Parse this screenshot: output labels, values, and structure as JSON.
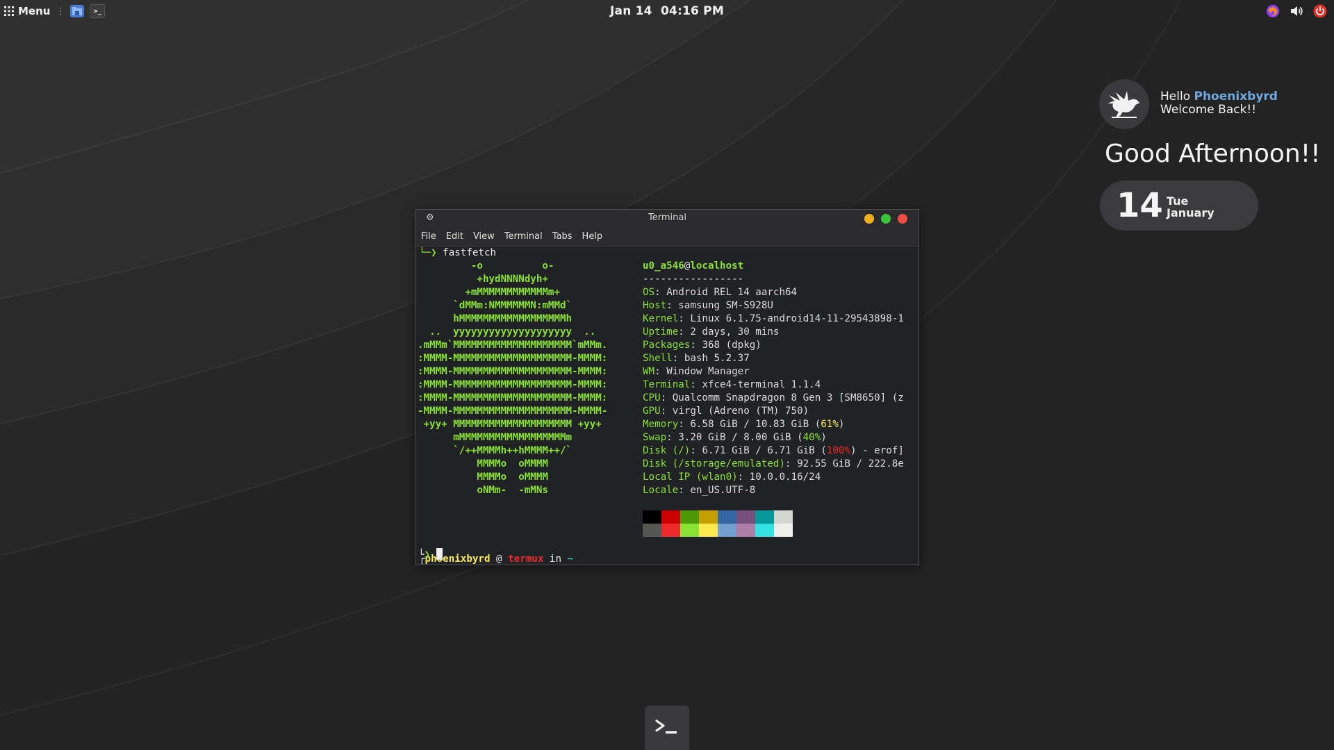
{
  "panel": {
    "menu_label": "Menu",
    "clock": "Jan 14  04:16 PM",
    "icons": [
      "apps-grid-icon",
      "file-manager-icon",
      "terminal-icon",
      "firefox-icon",
      "volume-icon",
      "power-icon"
    ]
  },
  "greeting": {
    "hello": "Hello",
    "user": "Phoenixbyrd",
    "welcome": "Welcome Back!!",
    "message": "Good Afternoon!!",
    "day_num": "14",
    "day_name": "Tue",
    "month": "January"
  },
  "terminal": {
    "title": "Terminal",
    "menu": [
      "File",
      "Edit",
      "View",
      "Terminal",
      "Tabs",
      "Help"
    ],
    "command_prefix": "└─❯ ",
    "command": "fastfetch",
    "logo": [
      "         -o          o-",
      "          +hydNNNNdyh+",
      "        +mMMMMMMMMMMMMm+",
      "      `dMMm:NMMMMMMN:mMMd`",
      "      hMMMMMMMMMMMMMMMMMMh",
      "  ..  yyyyyyyyyyyyyyyyyyyy  ..",
      ".mMMm`MMMMMMMMMMMMMMMMMMMM`mMMm.",
      ":MMMM-MMMMMMMMMMMMMMMMMMMM-MMMM:",
      ":MMMM-MMMMMMMMMMMMMMMMMMMM-MMMM:",
      ":MMMM-MMMMMMMMMMMMMMMMMMMM-MMMM:",
      ":MMMM-MMMMMMMMMMMMMMMMMMMM-MMMM:",
      "-MMMM-MMMMMMMMMMMMMMMMMMMM-MMMM-",
      " +yy+ MMMMMMMMMMMMMMMMMMMM +yy+",
      "      mMMMMMMMMMMMMMMMMMMm",
      "      `/++MMMMh++hMMMM++/`",
      "          MMMMo  oMMMM",
      "          MMMMo  oMMMM",
      "          oNMm-  -mMNs"
    ],
    "user": "u0_a546",
    "at": "@",
    "host": "localhost",
    "separator": "-----------------",
    "info": {
      "os_l": "OS",
      "os_v": "Android REL 14 aarch64",
      "host_l": "Host",
      "host_v": "samsung SM-S928U",
      "kernel_l": "Kernel",
      "kernel_v": "Linux 6.1.75-android14-11-29543898-1",
      "uptime_l": "Uptime",
      "uptime_v": "2 days, 30 mins",
      "packages_l": "Packages",
      "packages_v": "368 (dpkg)",
      "shell_l": "Shell",
      "shell_v": "bash 5.2.37",
      "wm_l": "WM",
      "wm_v": "Window Manager",
      "terminal_l": "Terminal",
      "terminal_v": "xfce4-terminal 1.1.4",
      "cpu_l": "CPU",
      "cpu_v": "Qualcomm Snapdragon 8 Gen 3 [SM8650] (z",
      "gpu_l": "GPU",
      "gpu_v": "virgl (Adreno (TM) 750)",
      "memory_l": "Memory",
      "memory_v": "6.58 GiB / 10.83 GiB (",
      "memory_pct": "61%",
      "memory_end": ")",
      "swap_l": "Swap",
      "swap_v": "3.20 GiB / 8.00 GiB (",
      "swap_pct": "40%",
      "swap_end": ")",
      "disk_l": "Disk (/)",
      "disk_v": "6.71 GiB / 6.71 GiB (",
      "disk_pct": "100%",
      "disk_end": ") - erof]",
      "disk2_l": "Disk (/storage/emulated)",
      "disk2_v": "92.55 GiB / 222.8e",
      "ip_l": "Local IP (wlan0)",
      "ip_v": "10.0.0.16/24",
      "locale_l": "Locale",
      "locale_v": "en_US.UTF-8"
    },
    "palette_top": [
      "#000000",
      "#cc0000",
      "#4e9a06",
      "#c4a000",
      "#3465a4",
      "#75507b",
      "#06989a",
      "#d3d7cf"
    ],
    "palette_bottom": [
      "#555753",
      "#ef2929",
      "#8ae234",
      "#fce94f",
      "#729fcf",
      "#ad7fa8",
      "#34e2e2",
      "#eeeeec"
    ],
    "prompt": {
      "corner": "┌",
      "user": "phoenixbyrd",
      "at": " @ ",
      "host": "termux",
      "in": " in ",
      "dir": "~",
      "arrow_prefix": "└",
      "arrow": "❯"
    }
  },
  "dock": {
    "icons": [
      "terminal-icon"
    ]
  }
}
